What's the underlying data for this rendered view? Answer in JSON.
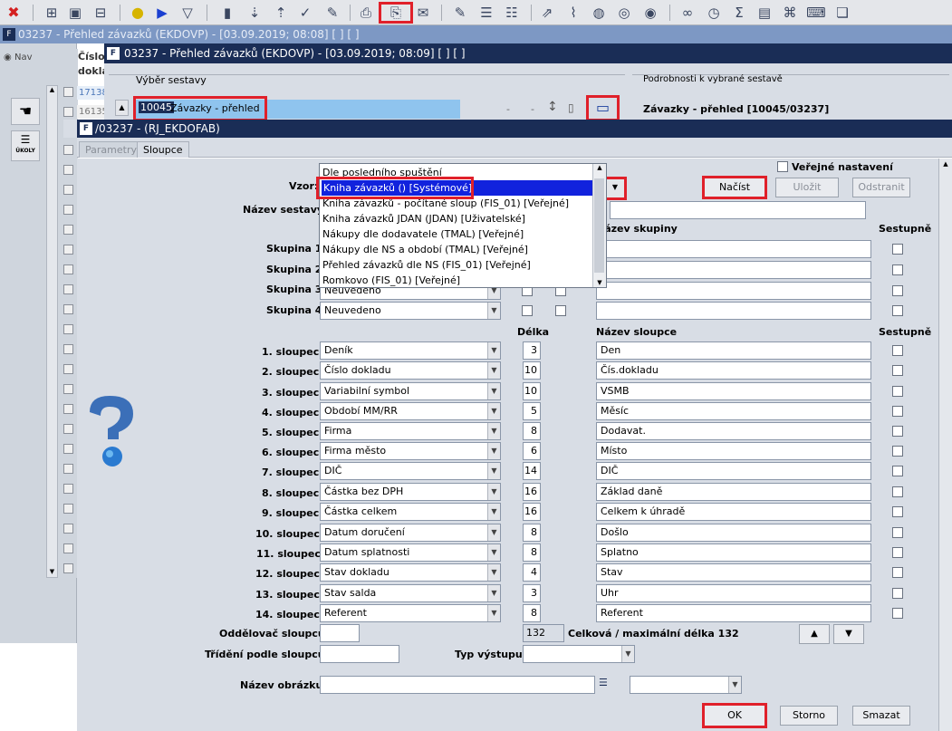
{
  "bg_window": {
    "title": "03237 - Přehled závazků (EKDOVP) - [03.09.2019; 08:08]  [ ]  [ ]",
    "nav_label": "Nav",
    "col_header_1": "Číslo",
    "col_header_2": "dokla",
    "rows": [
      "17138",
      "16135"
    ],
    "ukoly_label": "ÚKOLY"
  },
  "window2": {
    "title": "03237 - Přehled závazků (EKDOVP) - [03.09.2019; 08:09]  [ ]  [ ]",
    "vyber_label": "Výběr sestavy",
    "sestava_code": "10045",
    "sestava_name": "Závazky - přehled",
    "dash1": "-",
    "dash2": "-",
    "podrobnosti_label": "Podrobnosti k vybrané sestavě",
    "podrobnosti_value": "Závazky - přehled [10045/03237]"
  },
  "window3": {
    "title": "/03237 - (RJ_EKDOFAB)",
    "tabs": [
      "Parametry",
      "Sloupce"
    ],
    "vzor_label": "Vzor:",
    "nazev_sestavy_label": "Název sestavy:",
    "verejne_label": "Veřejné nastavení",
    "nacist_btn": "Načíst",
    "ulozit_btn": "Uložit",
    "odstranit_btn": "Odstranit",
    "nazev_skupiny_header": "Název skupiny",
    "sestupne_header": "Sestupně",
    "delka_header": "Délka",
    "nazev_sloupce_header": "Název sloupce",
    "groups": [
      {
        "label": "Skupina 1:",
        "value": ""
      },
      {
        "label": "Skupina 2:",
        "value": ""
      },
      {
        "label": "Skupina 3:",
        "value": "Neuvedeno"
      },
      {
        "label": "Skupina 4:",
        "value": "Neuvedeno"
      }
    ],
    "columns": [
      {
        "label": "1. sloupec:",
        "value": "Deník",
        "len": "3",
        "name": "Den"
      },
      {
        "label": "2. sloupec:",
        "value": "Číslo dokladu",
        "len": "10",
        "name": "Čís.dokladu"
      },
      {
        "label": "3. sloupec:",
        "value": "Variabilní symbol",
        "len": "10",
        "name": "VSMB"
      },
      {
        "label": "4. sloupec:",
        "value": "Období MM/RR",
        "len": "5",
        "name": "Měsíc"
      },
      {
        "label": "5. sloupec:",
        "value": "Firma",
        "len": "8",
        "name": "Dodavat."
      },
      {
        "label": "6. sloupec:",
        "value": "Firma město",
        "len": "6",
        "name": "Místo"
      },
      {
        "label": "7. sloupec:",
        "value": "DIČ",
        "len": "14",
        "name": "DIČ"
      },
      {
        "label": "8. sloupec:",
        "value": "Částka bez DPH",
        "len": "16",
        "name": "Základ daně"
      },
      {
        "label": "9. sloupec:",
        "value": "Částka celkem",
        "len": "16",
        "name": "Celkem k úhradě"
      },
      {
        "label": "10. sloupec:",
        "value": "Datum doručení",
        "len": "8",
        "name": "Došlo"
      },
      {
        "label": "11. sloupec:",
        "value": "Datum splatnosti",
        "len": "8",
        "name": "Splatno"
      },
      {
        "label": "12. sloupec:",
        "value": "Stav dokladu",
        "len": "4",
        "name": "Stav"
      },
      {
        "label": "13. sloupec:",
        "value": "Stav salda",
        "len": "3",
        "name": "Uhr"
      },
      {
        "label": "14. sloupec:",
        "value": "Referent",
        "len": "8",
        "name": "Referent"
      }
    ],
    "oddelovac_label": "Oddělovač sloupců:",
    "total_len": "132",
    "total_text": "Celková / maximální délka 132",
    "trideni_label": "Třídění podle sloupců:",
    "typ_vystupu_label": "Typ výstupu:",
    "nazev_obrazku_label": "Název obrázku:",
    "ok_btn": "OK",
    "storno_btn": "Storno",
    "smazat_btn": "Smazat"
  },
  "dropdown": {
    "items": [
      "Dle posledního spuštění",
      "Kniha závazků   ()   [Systémové]",
      "Kniha závazků - počítané sloup   (FIS_01)   [Veřejné]",
      "Kniha závazků JDAN   (JDAN)   [Uživatelské]",
      "Nákupy dle dodavatele   (TMAL)   [Veřejné]",
      "Nákupy dle NS a období   (TMAL)   [Veřejné]",
      "Přehled závazků dle NS   (FIS_01)   [Veřejné]",
      "Romkovo   (FIS_01)   [Veřejné]"
    ],
    "selected_index": 1
  },
  "colors": {
    "title_dark": "#1a2d56",
    "title_light": "#7d98c4",
    "highlight_red": "#e0202a",
    "selection_blue": "#1122dd",
    "field_blue": "#8fc4ee"
  }
}
